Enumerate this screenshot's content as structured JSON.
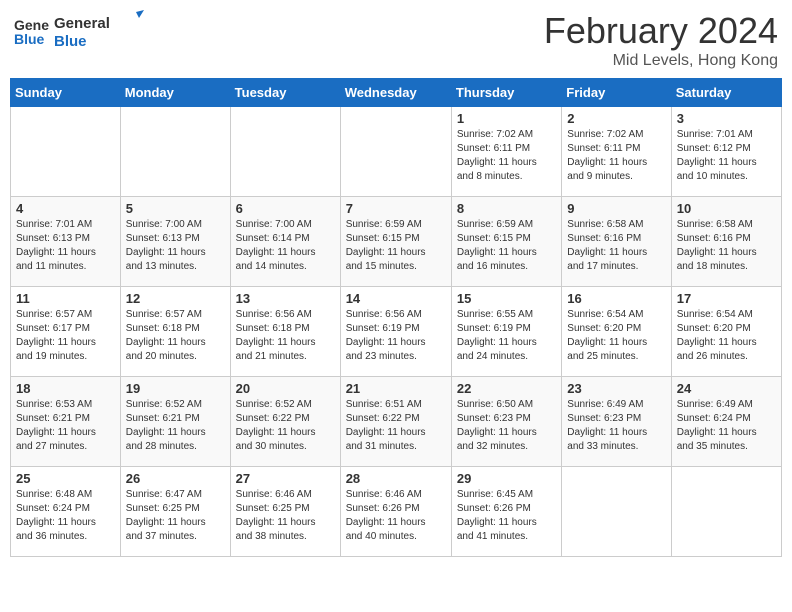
{
  "header": {
    "logo_general": "General",
    "logo_blue": "Blue",
    "title": "February 2024",
    "location": "Mid Levels, Hong Kong"
  },
  "weekdays": [
    "Sunday",
    "Monday",
    "Tuesday",
    "Wednesday",
    "Thursday",
    "Friday",
    "Saturday"
  ],
  "weeks": [
    [
      {
        "day": "",
        "info": ""
      },
      {
        "day": "",
        "info": ""
      },
      {
        "day": "",
        "info": ""
      },
      {
        "day": "",
        "info": ""
      },
      {
        "day": "1",
        "info": "Sunrise: 7:02 AM\nSunset: 6:11 PM\nDaylight: 11 hours\nand 8 minutes."
      },
      {
        "day": "2",
        "info": "Sunrise: 7:02 AM\nSunset: 6:11 PM\nDaylight: 11 hours\nand 9 minutes."
      },
      {
        "day": "3",
        "info": "Sunrise: 7:01 AM\nSunset: 6:12 PM\nDaylight: 11 hours\nand 10 minutes."
      }
    ],
    [
      {
        "day": "4",
        "info": "Sunrise: 7:01 AM\nSunset: 6:13 PM\nDaylight: 11 hours\nand 11 minutes."
      },
      {
        "day": "5",
        "info": "Sunrise: 7:00 AM\nSunset: 6:13 PM\nDaylight: 11 hours\nand 13 minutes."
      },
      {
        "day": "6",
        "info": "Sunrise: 7:00 AM\nSunset: 6:14 PM\nDaylight: 11 hours\nand 14 minutes."
      },
      {
        "day": "7",
        "info": "Sunrise: 6:59 AM\nSunset: 6:15 PM\nDaylight: 11 hours\nand 15 minutes."
      },
      {
        "day": "8",
        "info": "Sunrise: 6:59 AM\nSunset: 6:15 PM\nDaylight: 11 hours\nand 16 minutes."
      },
      {
        "day": "9",
        "info": "Sunrise: 6:58 AM\nSunset: 6:16 PM\nDaylight: 11 hours\nand 17 minutes."
      },
      {
        "day": "10",
        "info": "Sunrise: 6:58 AM\nSunset: 6:16 PM\nDaylight: 11 hours\nand 18 minutes."
      }
    ],
    [
      {
        "day": "11",
        "info": "Sunrise: 6:57 AM\nSunset: 6:17 PM\nDaylight: 11 hours\nand 19 minutes."
      },
      {
        "day": "12",
        "info": "Sunrise: 6:57 AM\nSunset: 6:18 PM\nDaylight: 11 hours\nand 20 minutes."
      },
      {
        "day": "13",
        "info": "Sunrise: 6:56 AM\nSunset: 6:18 PM\nDaylight: 11 hours\nand 21 minutes."
      },
      {
        "day": "14",
        "info": "Sunrise: 6:56 AM\nSunset: 6:19 PM\nDaylight: 11 hours\nand 23 minutes."
      },
      {
        "day": "15",
        "info": "Sunrise: 6:55 AM\nSunset: 6:19 PM\nDaylight: 11 hours\nand 24 minutes."
      },
      {
        "day": "16",
        "info": "Sunrise: 6:54 AM\nSunset: 6:20 PM\nDaylight: 11 hours\nand 25 minutes."
      },
      {
        "day": "17",
        "info": "Sunrise: 6:54 AM\nSunset: 6:20 PM\nDaylight: 11 hours\nand 26 minutes."
      }
    ],
    [
      {
        "day": "18",
        "info": "Sunrise: 6:53 AM\nSunset: 6:21 PM\nDaylight: 11 hours\nand 27 minutes."
      },
      {
        "day": "19",
        "info": "Sunrise: 6:52 AM\nSunset: 6:21 PM\nDaylight: 11 hours\nand 28 minutes."
      },
      {
        "day": "20",
        "info": "Sunrise: 6:52 AM\nSunset: 6:22 PM\nDaylight: 11 hours\nand 30 minutes."
      },
      {
        "day": "21",
        "info": "Sunrise: 6:51 AM\nSunset: 6:22 PM\nDaylight: 11 hours\nand 31 minutes."
      },
      {
        "day": "22",
        "info": "Sunrise: 6:50 AM\nSunset: 6:23 PM\nDaylight: 11 hours\nand 32 minutes."
      },
      {
        "day": "23",
        "info": "Sunrise: 6:49 AM\nSunset: 6:23 PM\nDaylight: 11 hours\nand 33 minutes."
      },
      {
        "day": "24",
        "info": "Sunrise: 6:49 AM\nSunset: 6:24 PM\nDaylight: 11 hours\nand 35 minutes."
      }
    ],
    [
      {
        "day": "25",
        "info": "Sunrise: 6:48 AM\nSunset: 6:24 PM\nDaylight: 11 hours\nand 36 minutes."
      },
      {
        "day": "26",
        "info": "Sunrise: 6:47 AM\nSunset: 6:25 PM\nDaylight: 11 hours\nand 37 minutes."
      },
      {
        "day": "27",
        "info": "Sunrise: 6:46 AM\nSunset: 6:25 PM\nDaylight: 11 hours\nand 38 minutes."
      },
      {
        "day": "28",
        "info": "Sunrise: 6:46 AM\nSunset: 6:26 PM\nDaylight: 11 hours\nand 40 minutes."
      },
      {
        "day": "29",
        "info": "Sunrise: 6:45 AM\nSunset: 6:26 PM\nDaylight: 11 hours\nand 41 minutes."
      },
      {
        "day": "",
        "info": ""
      },
      {
        "day": "",
        "info": ""
      }
    ]
  ]
}
